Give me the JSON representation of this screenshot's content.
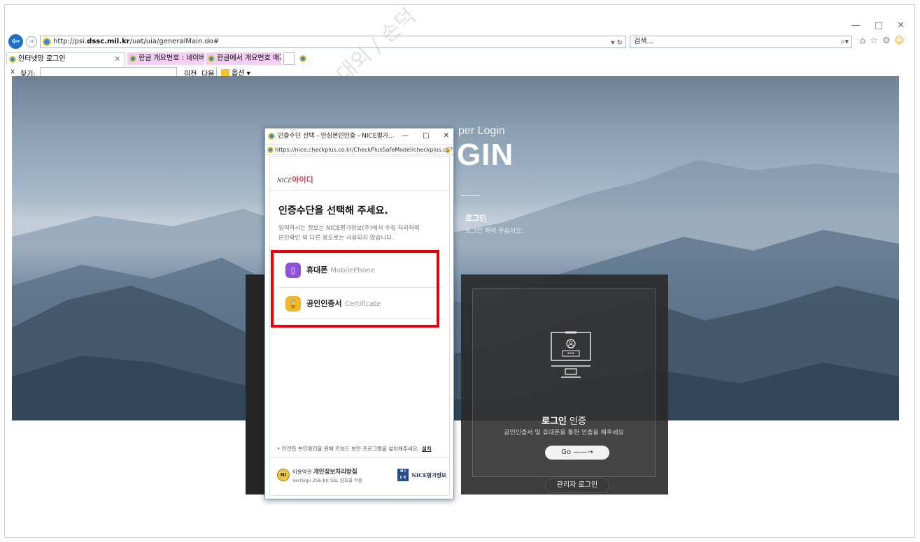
{
  "browser": {
    "url_prefix": "http://psi.",
    "url_domain": "dssc.mil.kr",
    "url_path": "/uat/uia/generalMain.do#",
    "addr_tools": "▾ ↻",
    "search_placeholder": "검색...",
    "search_icon": "search-icon",
    "window_controls": [
      "—",
      "□",
      "✕"
    ],
    "toolbar_icons": [
      "home-icon",
      "star-icon",
      "gear-icon",
      "smiley-icon"
    ]
  },
  "tabs": [
    {
      "label": "인터넷망 로그인",
      "close": "×"
    },
    {
      "label": "한글 개요번호 : 네이버 지식IN..."
    },
    {
      "label": "한글에서 개요번호 매기는 방..."
    }
  ],
  "findbar": {
    "close": "x",
    "label": "찾기:",
    "prev": "이전",
    "next": "다음",
    "options": "옵션 ▾"
  },
  "watermark": "대외 / 손덕",
  "hero": {
    "title": "per Login",
    "big": "GIN",
    "sub": "로그인",
    "sub2": "로그인 하여 주십시오."
  },
  "login_box": {
    "title_bold": "로그인",
    "title_rest": " 인증",
    "desc": "공인인증서 및 휴대폰을 통한 인증을 해주세요",
    "go_label": "Go ——→",
    "admin_label": "관리자 로그인",
    "monitor_code": "***"
  },
  "popup": {
    "window_title": "인증수단 선택 - 안심본인인증 - NICE평가...",
    "window_controls": [
      "—",
      "□",
      "✕"
    ],
    "url": "https://nice.checkplus.co.kr/CheckPlusSafeModel/checkplus.cb?m=",
    "brand_prefix": "NICE",
    "brand_name": "아이디",
    "heading": "인증수단을 선택해 주세요.",
    "description_line1": "입력하시는 정보는 NICE평가정보(주)에서 수집 처리하며",
    "description_line2": "본인확인 외 다른 용도로는 사용되지 않습니다.",
    "methods": [
      {
        "label": "휴대폰",
        "sub": "MobilePhone",
        "icon": "phone-icon"
      },
      {
        "label": "공인인증서",
        "sub": "Certificate",
        "icon": "lock-icon"
      }
    ],
    "install_note": "• 안전한 본인확인을 위해 키보드 보안 프로그램을 설치해주세요.",
    "install_link": "설치",
    "footer_prefix": "이용약관 ",
    "footer_policy": "개인정보처리방침",
    "footer_ssl": "VeriSign 256-bit SSL 암호화 적용",
    "footer_badge": "NI",
    "nice_box_top": "N I",
    "nice_box_bottom": "C E",
    "nice_text": "NICE평가정보"
  },
  "colors": {
    "highlight_red": "#e4000f",
    "phone_purple": "#8d52d8",
    "cert_yellow": "#f2b52b",
    "ie_blue": "#1d6fc8"
  }
}
